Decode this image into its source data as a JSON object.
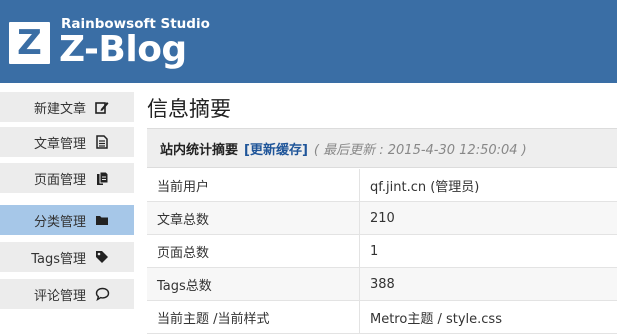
{
  "header": {
    "studio": "Rainbowsoft Studio",
    "brand": "Z-Blog",
    "logo_letter": "Z",
    "colors": {
      "header_bg": "#3a6ea5",
      "active_item": "#a6c7e8",
      "link": "#1f5599"
    }
  },
  "sidebar": {
    "items": [
      {
        "label": "新建文章",
        "icon": "edit-icon",
        "active": false
      },
      {
        "label": "文章管理",
        "icon": "document-icon",
        "active": false
      },
      {
        "label": "页面管理",
        "icon": "documents-icon",
        "active": false
      },
      {
        "label": "分类管理",
        "icon": "folder-icon",
        "active": true
      },
      {
        "label": "Tags管理",
        "icon": "tag-icon",
        "active": false
      },
      {
        "label": "评论管理",
        "icon": "comment-icon",
        "active": false
      }
    ]
  },
  "main": {
    "title": "信息摘要",
    "summary": {
      "title": "站内统计摘要",
      "refresh_link": "[更新缓存]",
      "last_update": "( 最后更新 : 2015-4-30 12:50:04 )"
    },
    "rows": [
      {
        "key": "当前用户",
        "value": "qf.jint.cn (管理员)"
      },
      {
        "key": "文章总数",
        "value": "210"
      },
      {
        "key": "页面总数",
        "value": "1"
      },
      {
        "key": "Tags总数",
        "value": "388"
      },
      {
        "key": "当前主题 /当前样式",
        "value": "Metro主题 / style.css"
      }
    ]
  }
}
